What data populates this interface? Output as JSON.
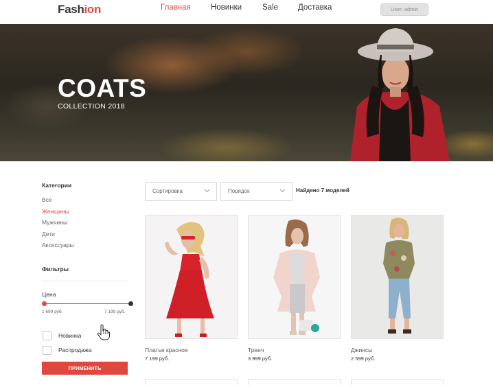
{
  "header": {
    "logo_part1": "Fash",
    "logo_part2": "ion",
    "nav": [
      {
        "label": "Главная",
        "active": true
      },
      {
        "label": "Новинки",
        "active": false
      },
      {
        "label": "Sale",
        "active": false
      },
      {
        "label": "Доставка",
        "active": false
      }
    ],
    "user_label": "User: admin"
  },
  "hero": {
    "title": "COATS",
    "subtitle": "COLLECTION 2018"
  },
  "sidebar": {
    "categories_title": "Категории",
    "categories": [
      {
        "label": "Все",
        "active": false
      },
      {
        "label": "Женщины",
        "active": true
      },
      {
        "label": "Мужчины",
        "active": false
      },
      {
        "label": "Дети",
        "active": false
      },
      {
        "label": "Аксессуары",
        "active": false
      }
    ],
    "filters_title": "Фильтры",
    "price_label": "Цена",
    "price_min": "1 699 руб.",
    "price_max": "7 199 руб.",
    "checkboxes": [
      {
        "label": "Новинка",
        "checked": false
      },
      {
        "label": "Распродажа",
        "checked": false
      }
    ],
    "apply_label": "ПРИМЕНИТЬ"
  },
  "toolbar": {
    "sort_label": "Сортировка",
    "order_label": "Порядок",
    "found_text": "Найдено 7 моделей"
  },
  "products": [
    {
      "name": "Платье красное",
      "price": "7 199 руб."
    },
    {
      "name": "Тренч",
      "price": "3 999 руб."
    },
    {
      "name": "Джинсы",
      "price": "2 599 руб."
    }
  ],
  "colors": {
    "accent": "#e0483e",
    "text": "#333333"
  },
  "icons": [
    "chevron-down-icon",
    "hand-cursor-icon"
  ]
}
